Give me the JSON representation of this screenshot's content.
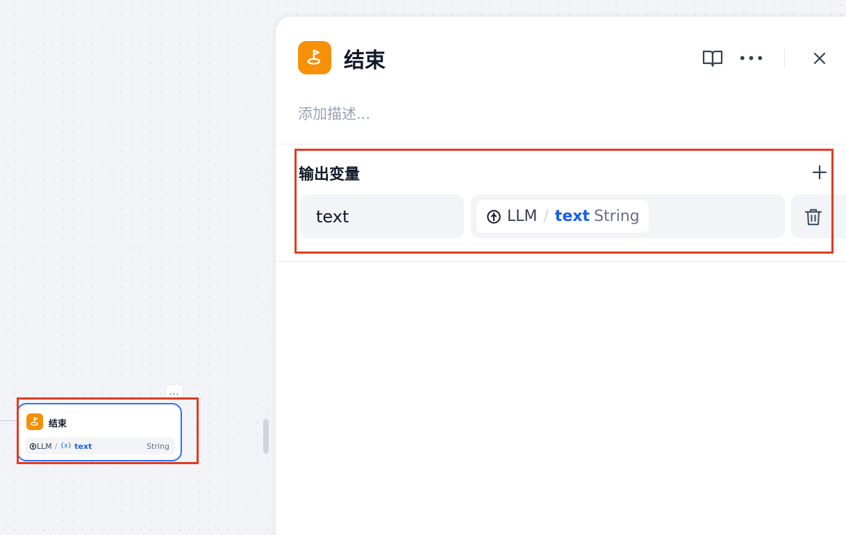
{
  "canvas": {
    "node": {
      "more_label": "...",
      "icon": "end-icon",
      "title": "结束",
      "var_source_icon": "llm-icon",
      "var_source": "LLM",
      "var_slash": "/",
      "var_brace": "{x}",
      "var_name": "text",
      "var_type": "String"
    }
  },
  "panel": {
    "icon": "end-icon",
    "title": "结束",
    "header_buttons": [
      "book-icon",
      "more-icon",
      "close-icon"
    ],
    "more_label": "•••",
    "description_placeholder": "添加描述...",
    "output_section": {
      "title": "输出变量",
      "add_icon": "plus-icon",
      "variables": [
        {
          "name": "text",
          "source_icon": "llm-icon",
          "source": "LLM",
          "slash": "/",
          "ref_name": "text",
          "ref_type": "String",
          "delete_icon": "trash-icon"
        }
      ]
    }
  },
  "colors": {
    "accent_orange": "#f79009",
    "blue": "#155eef",
    "highlight_red": "#e5381f",
    "node_border": "#2970ff"
  }
}
